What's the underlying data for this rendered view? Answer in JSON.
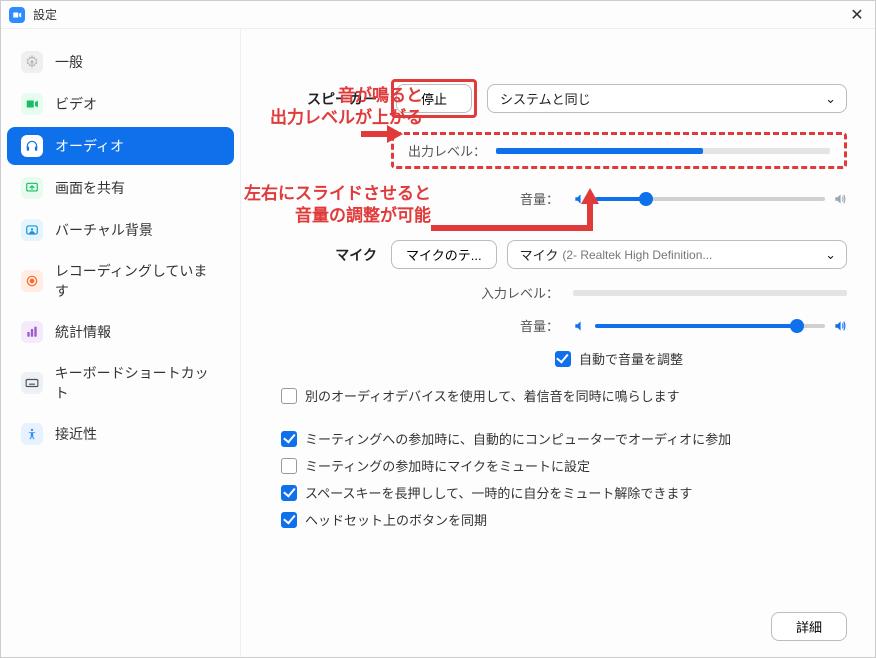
{
  "window": {
    "title": "設定"
  },
  "sidebar": {
    "items": [
      {
        "label": "一般",
        "icon": "gear",
        "color": "#d6d6d6"
      },
      {
        "label": "ビデオ",
        "icon": "video",
        "color": "#2ecc71"
      },
      {
        "label": "オーディオ",
        "icon": "audio",
        "color": "#ffffff"
      },
      {
        "label": "画面を共有",
        "icon": "share",
        "color": "#2ecc71"
      },
      {
        "label": "バーチャル背景",
        "icon": "bg",
        "color": "#29b6f6"
      },
      {
        "label": "レコーディングしています",
        "icon": "rec",
        "color": "#ff7043"
      },
      {
        "label": "統計情報",
        "icon": "stats",
        "color": "#ab47bc"
      },
      {
        "label": "キーボードショートカット",
        "icon": "kbd",
        "color": "#47525e"
      },
      {
        "label": "接近性",
        "icon": "access",
        "color": "#2d8cff"
      }
    ],
    "active_index": 2
  },
  "speaker": {
    "section_label": "スピーカー",
    "stop_button": "停止",
    "device_select": "システムと同じ",
    "output_level_label": "出力レベル：",
    "output_level_percent": 62,
    "volume_label": "音量：",
    "volume_percent": 22
  },
  "mic": {
    "section_label": "マイク",
    "test_button": "マイクのテ...",
    "device_select_prefix": "マイク",
    "device_select_detail": "(2- Realtek High Definition...",
    "input_level_label": "入力レベル：",
    "input_level_percent": 0,
    "volume_label": "音量：",
    "volume_percent": 88,
    "auto_adjust_label": "自動で音量を調整",
    "auto_adjust_checked": true
  },
  "options": [
    {
      "label": "別のオーディオデバイスを使用して、着信音を同時に鳴らします",
      "checked": false
    },
    {
      "label": "ミーティングへの参加時に、自動的にコンピューターでオーディオに参加",
      "checked": true
    },
    {
      "label": "ミーティングの参加時にマイクをミュートに設定",
      "checked": false
    },
    {
      "label": "スペースキーを長押しして、一時的に自分をミュート解除できます",
      "checked": true
    },
    {
      "label": "ヘッドセット上のボタンを同期",
      "checked": true
    }
  ],
  "footer": {
    "advanced_button": "詳細"
  },
  "annotations": {
    "a1_line1": "音が鳴ると",
    "a1_line2": "出力レベルが上がる",
    "a2_line1": "左右にスライドさせると",
    "a2_line2": "音量の調整が可能"
  }
}
